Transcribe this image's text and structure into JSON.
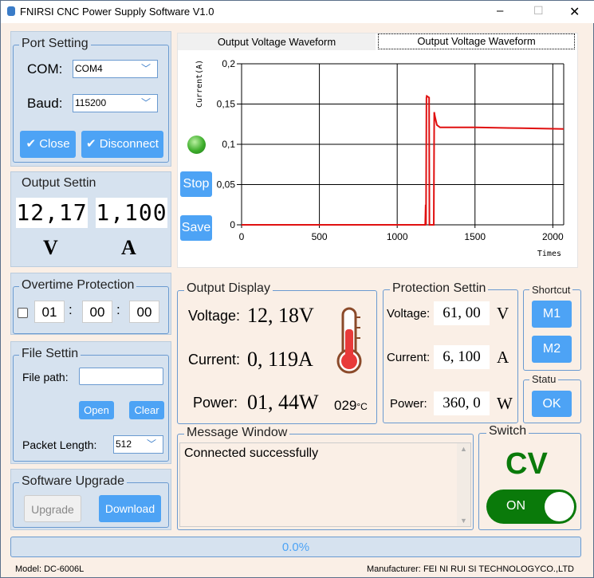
{
  "window": {
    "title": "FNIRSI CNC Power Supply Software V1.0",
    "minimize": "–",
    "maximize": "☐",
    "close": "✕"
  },
  "port": {
    "legend": "Port Setting",
    "com_label": "COM:",
    "com_value": "COM4",
    "baud_label": "Baud:",
    "baud_value": "115200",
    "close_label": "Close",
    "disconnect_label": "Disconnect"
  },
  "output_setting": {
    "legend": "Output Settin",
    "voltage": "12,17",
    "current": "1,100",
    "v_unit": "V",
    "a_unit": "A"
  },
  "overtime": {
    "legend": "Overtime Protection",
    "h": "01",
    "m": "00",
    "s": "00",
    "sep": ":"
  },
  "file": {
    "legend": "File Settin",
    "path_label": "File path:",
    "path_value": "",
    "open": "Open",
    "clear": "Clear",
    "packet_label": "Packet Length:",
    "packet_value": "512"
  },
  "upgrade": {
    "legend": "Software Upgrade",
    "upgrade": "Upgrade",
    "download": "Download"
  },
  "tabs": [
    "Output Voltage Waveform",
    "Output Voltage Waveform"
  ],
  "chart_controls": {
    "stop": "Stop",
    "save": "Save"
  },
  "chart_data": {
    "type": "line",
    "ylabel": "Current(A)",
    "xlabel": "Times",
    "xlim": [
      0,
      2070
    ],
    "ylim": [
      0,
      0.2
    ],
    "xticks": [
      "0",
      "500",
      "1000",
      "1500",
      "2000"
    ],
    "xtick_values": [
      0,
      500,
      1000,
      1500,
      2000
    ],
    "yticks": [
      "0",
      "0,05",
      "0,1",
      "0,15",
      "0,2"
    ],
    "ytick_values": [
      0,
      0.05,
      0.1,
      0.15,
      0.2
    ],
    "grid": true,
    "series": [
      {
        "name": "Current",
        "color": "#e01010",
        "x": [
          0,
          1180,
          1183,
          1185,
          1188,
          1190,
          1205,
          1207,
          1235,
          1238,
          1242,
          1255,
          1275,
          1500,
          1800,
          2070
        ],
        "y": [
          0,
          0,
          0.025,
          0,
          0.158,
          0.16,
          0.158,
          0,
          0,
          0.14,
          0.135,
          0.124,
          0.121,
          0.121,
          0.12,
          0.119
        ]
      }
    ]
  },
  "output_display": {
    "legend": "Output Display",
    "voltage_label": "Voltage:",
    "voltage": "12, 18V",
    "current_label": "Current:",
    "current": "0, 119A",
    "power_label": "Power:",
    "power": "01, 44W",
    "temp": "029",
    "temp_unit": "°C"
  },
  "protection": {
    "legend": "Protection Settin",
    "voltage_label": "Voltage:",
    "voltage": "61, 00",
    "v_unit": "V",
    "current_label": "Current:",
    "current": "6, 100",
    "a_unit": "A",
    "power_label": "Power:",
    "power": "360, 0",
    "w_unit": "W"
  },
  "shortcut": {
    "legend": "Shortcut",
    "m1": "M1",
    "m2": "M2"
  },
  "status": {
    "legend": "Statu",
    "ok": "OK"
  },
  "message": {
    "legend": "Message Window",
    "text": "Connected successfully"
  },
  "switch": {
    "legend": "Switch",
    "mode": "CV",
    "toggle": "ON"
  },
  "progress": {
    "text": "0.0%",
    "value": 0
  },
  "footer": {
    "model_label": "Model:",
    "model": "DC-6006L",
    "manufacturer_label": "Manufacturer:",
    "manufacturer": "FEI NI RUI SI TECHNOLOGYCO.,LTD"
  }
}
